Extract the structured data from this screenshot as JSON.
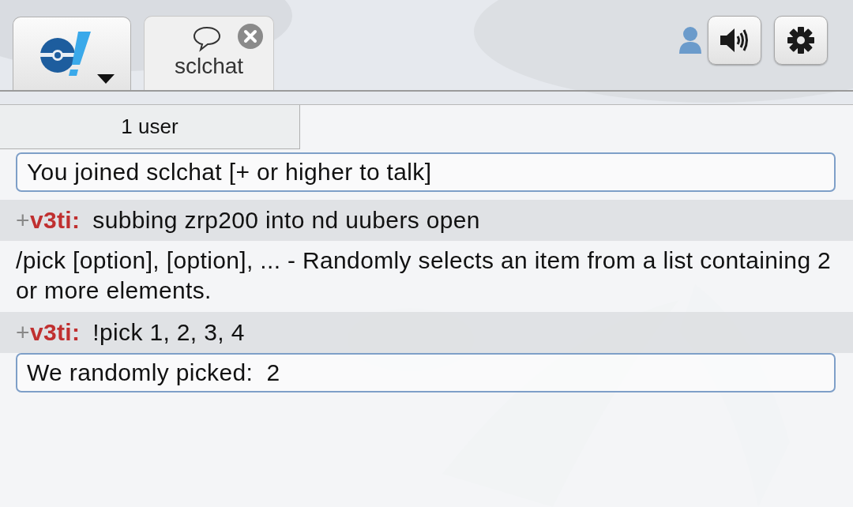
{
  "header": {
    "tabs": [
      {
        "label": "sclchat",
        "selected": true
      }
    ]
  },
  "userlist": {
    "label": "1 user"
  },
  "messages": [
    {
      "kind": "notice",
      "text": "You joined sclchat [+ or higher to talk]"
    },
    {
      "kind": "chat",
      "rank": "+",
      "user": "v3ti:",
      "text": "subbing zrp200 into nd uubers open"
    },
    {
      "kind": "info",
      "text": "/pick [option], [option], ... - Randomly selects an item from a list containing 2 or more elements."
    },
    {
      "kind": "chat",
      "rank": "+",
      "user": "v3ti:",
      "text": "!pick 1, 2, 3, 4"
    },
    {
      "kind": "notice",
      "text": "We randomly picked:  2"
    }
  ]
}
